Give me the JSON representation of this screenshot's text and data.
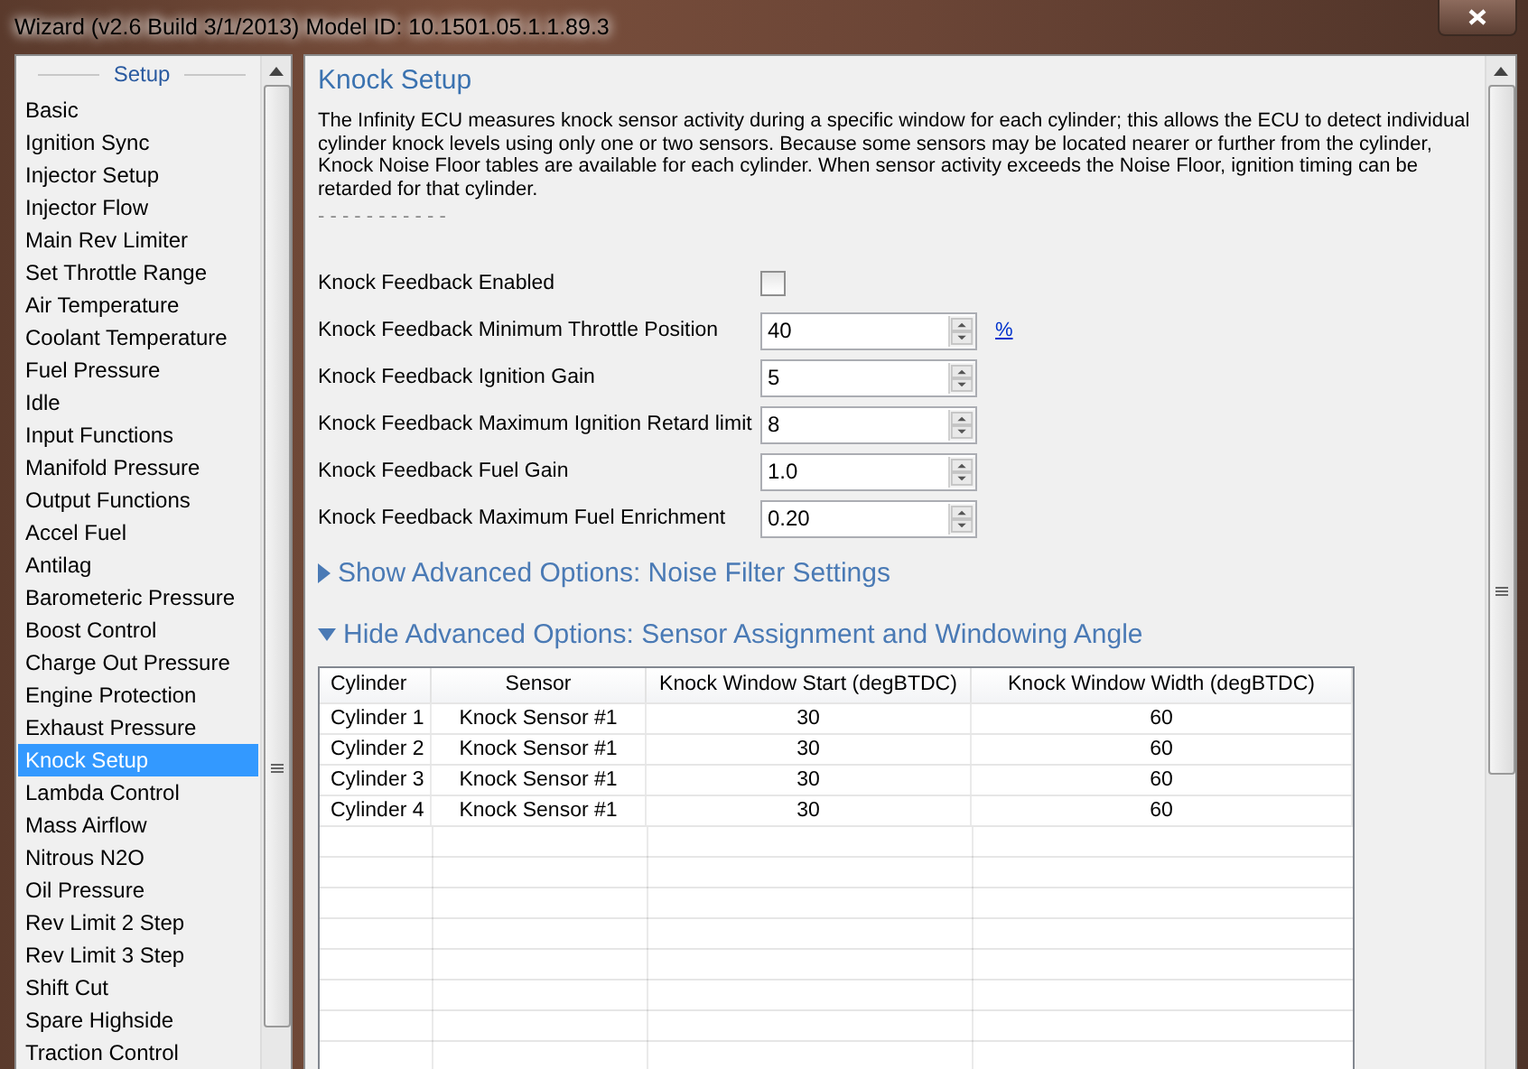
{
  "window": {
    "title": "Wizard (v2.6 Build 3/1/2013) Model ID: 10.1501.05.1.1.89.3"
  },
  "sidebar": {
    "heading": "Setup",
    "items": [
      {
        "label": "Basic",
        "selected": false
      },
      {
        "label": "Ignition Sync",
        "selected": false
      },
      {
        "label": "Injector Setup",
        "selected": false
      },
      {
        "label": "Injector Flow",
        "selected": false
      },
      {
        "label": "Main Rev Limiter",
        "selected": false
      },
      {
        "label": "Set Throttle Range",
        "selected": false
      },
      {
        "label": "Air Temperature",
        "selected": false
      },
      {
        "label": "Coolant Temperature",
        "selected": false
      },
      {
        "label": "Fuel Pressure",
        "selected": false
      },
      {
        "label": "Idle",
        "selected": false
      },
      {
        "label": "Input Functions",
        "selected": false
      },
      {
        "label": "Manifold Pressure",
        "selected": false
      },
      {
        "label": "Output Functions",
        "selected": false
      },
      {
        "label": "Accel Fuel",
        "selected": false
      },
      {
        "label": "Antilag",
        "selected": false
      },
      {
        "label": "Barometeric Pressure",
        "selected": false
      },
      {
        "label": "Boost Control",
        "selected": false
      },
      {
        "label": "Charge Out Pressure",
        "selected": false
      },
      {
        "label": "Engine Protection",
        "selected": false
      },
      {
        "label": "Exhaust Pressure",
        "selected": false
      },
      {
        "label": "Knock Setup",
        "selected": true
      },
      {
        "label": "Lambda Control",
        "selected": false
      },
      {
        "label": "Mass Airflow",
        "selected": false
      },
      {
        "label": "Nitrous N2O",
        "selected": false
      },
      {
        "label": "Oil Pressure",
        "selected": false
      },
      {
        "label": "Rev Limit 2 Step",
        "selected": false
      },
      {
        "label": "Rev Limit 3 Step",
        "selected": false
      },
      {
        "label": "Shift Cut",
        "selected": false
      },
      {
        "label": "Spare Highside",
        "selected": false
      },
      {
        "label": "Traction Control",
        "selected": false
      }
    ]
  },
  "page": {
    "title": "Knock Setup",
    "description": "The Infinity ECU measures knock sensor activity during a specific window for each cylinder; this allows the ECU to detect individual cylinder knock levels using only one or two sensors. Because some sensors may be located nearer or further from the cylinder, Knock Noise Floor tables are available for each cylinder. When sensor activity exceeds the Noise Floor, ignition timing can be retarded for that cylinder.",
    "separator": "- - - - - - - - - - -",
    "settings": [
      {
        "kind": "checkbox",
        "label": "Knock Feedback Enabled",
        "checked": false
      },
      {
        "kind": "spin",
        "label": "Knock Feedback Minimum Throttle Position",
        "value": "40",
        "unit": "%"
      },
      {
        "kind": "spin",
        "label": "Knock Feedback Ignition Gain",
        "value": "5"
      },
      {
        "kind": "spin",
        "label": "Knock Feedback Maximum Ignition Retard limit",
        "value": "8"
      },
      {
        "kind": "spin",
        "label": "Knock Feedback Fuel Gain",
        "value": "1.0"
      },
      {
        "kind": "spin",
        "label": "Knock Feedback Maximum Fuel Enrichment",
        "value": "0.20"
      }
    ],
    "sections": [
      {
        "label": "Show Advanced Options: Noise Filter Settings",
        "expanded": false
      },
      {
        "label": "Hide Advanced Options: Sensor Assignment and Windowing Angle",
        "expanded": true
      }
    ],
    "table": {
      "columns": [
        "Cylinder",
        "Sensor",
        "Knock Window Start (degBTDC)",
        "Knock Window Width (degBTDC)"
      ],
      "rows": [
        [
          "Cylinder 1",
          "Knock Sensor #1",
          "30",
          "60"
        ],
        [
          "Cylinder 2",
          "Knock Sensor #1",
          "30",
          "60"
        ],
        [
          "Cylinder 3",
          "Knock Sensor #1",
          "30",
          "60"
        ],
        [
          "Cylinder 4",
          "Knock Sensor #1",
          "30",
          "60"
        ]
      ]
    }
  }
}
